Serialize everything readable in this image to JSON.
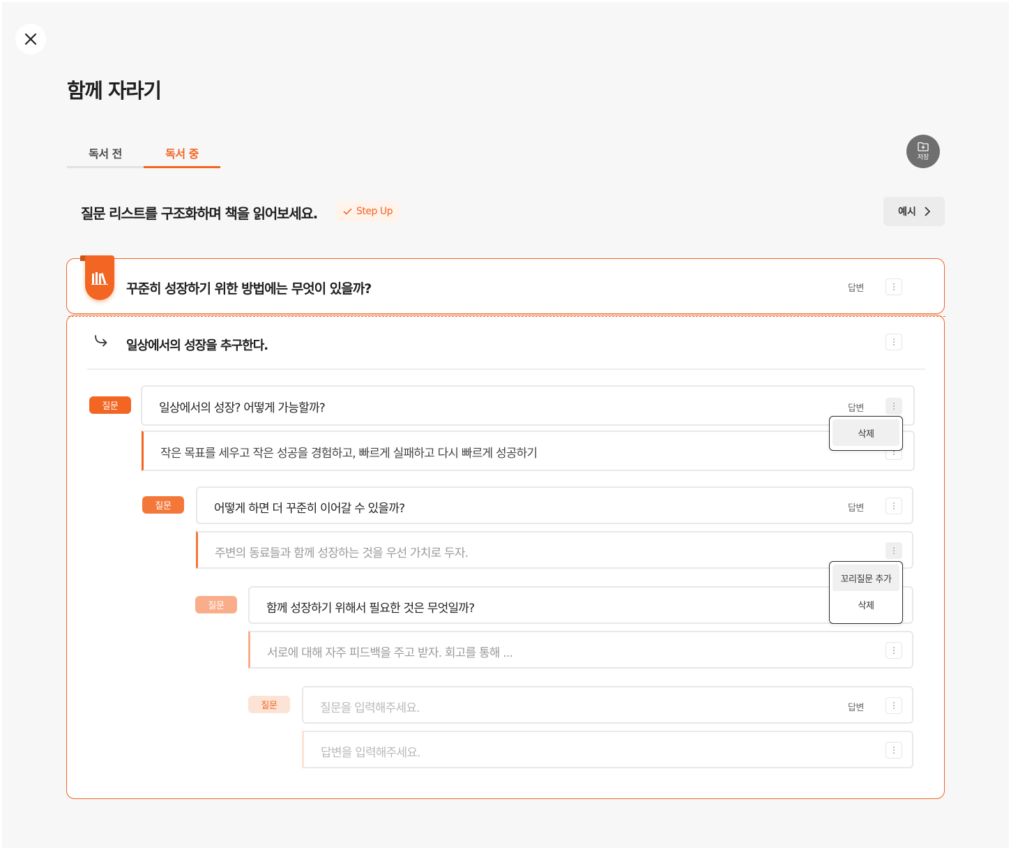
{
  "page": {
    "title": "함께 자라기",
    "close_icon": "close-icon"
  },
  "tabs": [
    {
      "label": "독서 전",
      "active": false
    },
    {
      "label": "독서 중",
      "active": true
    }
  ],
  "save_button": {
    "label": "저장",
    "icon": "folder-plus-icon"
  },
  "section": {
    "heading": "질문 리스트를 구조화하며 책을 읽어보세요.",
    "badge": "Step Up",
    "badge_icon": "check-icon",
    "example_label": "예시",
    "example_icon": "chevron-right-icon"
  },
  "main_question": {
    "icon": "books-icon",
    "text": "꾸준히 성장하기 위한 방법에는 무엇이 있을까?",
    "answer_label": "답변"
  },
  "sub_answer": {
    "icon": "reply-arrow-icon",
    "text": "일상에서의 성장을 추구한다."
  },
  "questions": [
    {
      "tag": "질문",
      "question": "일상에서의 성장? 어떻게 가능할까?",
      "answer_label": "답변",
      "answer": "작은 목표를 세우고 작은 성공을 경험하고, 빠르게 실패하고 다시 빠르게 성공하기"
    },
    {
      "tag": "질문",
      "question": "어떻게 하면 더 꾸준히 이어갈 수 있을까?",
      "answer_label": "답변",
      "answer": "주변의 동료들과 함께 성장하는 것을 우선 가치로 두자."
    },
    {
      "tag": "질문",
      "question": "함께 성장하기 위해서 필요한 것은 무엇일까?",
      "answer": "서로에 대해 자주 피드백을 주고 받자. 회고를 통해 ..."
    },
    {
      "tag": "질문",
      "question_placeholder": "질문을 입력해주세요.",
      "answer_label": "답변",
      "answer_placeholder": "답변을 입력해주세요."
    }
  ],
  "menus": {
    "delete_menu": [
      "삭제"
    ],
    "answer_menu": [
      "꼬리질문 추가",
      "삭제"
    ]
  },
  "colors": {
    "accent": "#f26522",
    "background": "#f7f7f7"
  }
}
